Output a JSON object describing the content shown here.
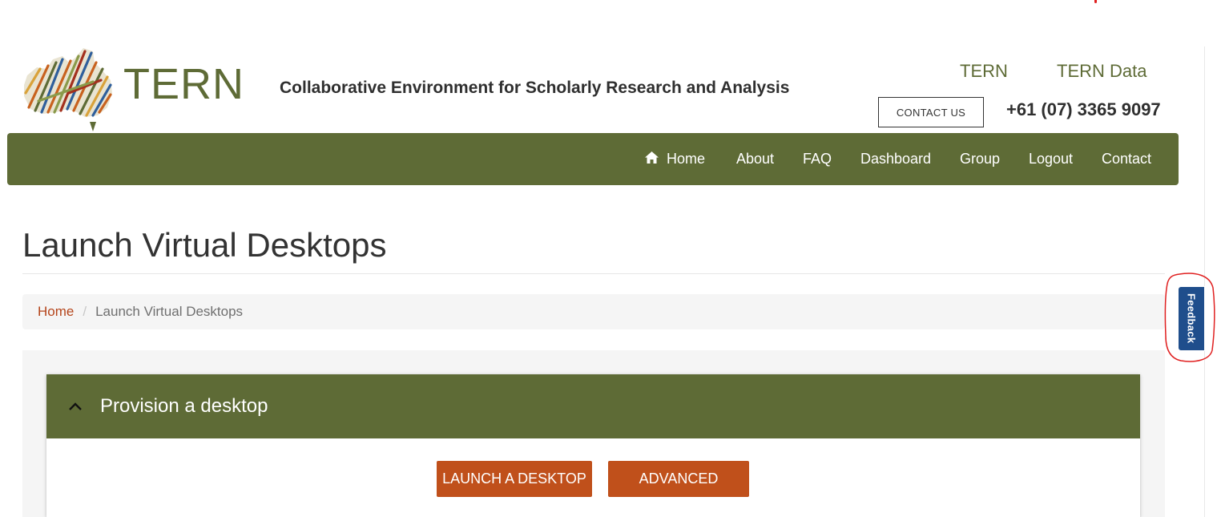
{
  "header": {
    "logo_text": "TERN",
    "tagline": "Collaborative Environment for Scholarly Research and Analysis",
    "top_links": [
      "TERN",
      "TERN Data"
    ],
    "contact_button": "CONTACT US",
    "phone": "+61 (07) 3365 9097"
  },
  "nav": {
    "items": [
      "Home",
      "About",
      "FAQ",
      "Dashboard",
      "Group",
      "Logout",
      "Contact"
    ]
  },
  "page": {
    "title": "Launch Virtual Desktops"
  },
  "breadcrumb": {
    "home": "Home",
    "separator": "/",
    "current": "Launch Virtual Desktops"
  },
  "panel": {
    "title": "Provision a desktop",
    "primary_button": "LAUNCH A DESKTOP",
    "secondary_button": "ADVANCED"
  },
  "feedback": {
    "label": "Feedback"
  },
  "colors": {
    "brand_green": "#5e6b36",
    "accent_orange": "#c0501b",
    "link_orange": "#b5451b",
    "feedback_blue": "#1f4e8c",
    "annotation_red": "#e02020"
  },
  "icons": {
    "home": "home-icon",
    "chevron": "chevron-up-icon"
  }
}
